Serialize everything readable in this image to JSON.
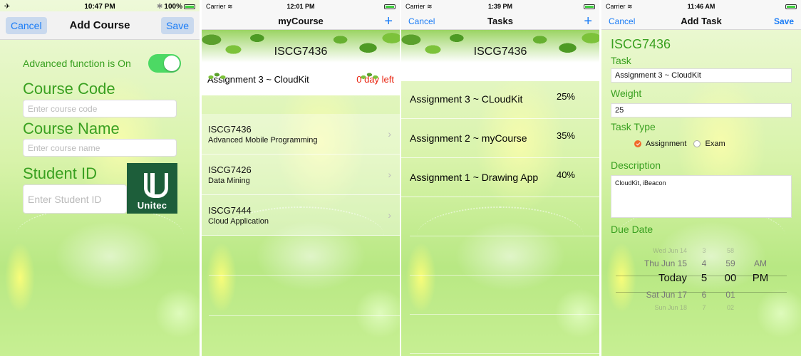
{
  "screen1": {
    "status": {
      "time": "10:47 PM",
      "battery": "100%"
    },
    "nav": {
      "cancel": "Cancel",
      "title": "Add Course",
      "save": "Save"
    },
    "advanced_label": "Advanced function is On",
    "course_code_label": "Course Code",
    "course_code_placeholder": "Enter course code",
    "course_name_label": "Course Name",
    "course_name_placeholder": "Enter course name",
    "student_id_label": "Student ID",
    "student_id_placeholder": "Enter Student ID",
    "logo_text": "Unitec"
  },
  "screen2": {
    "status": {
      "carrier": "Carrier",
      "time": "12:01 PM"
    },
    "nav": {
      "title": "myCourse",
      "add": "+"
    },
    "banner_title": "ISCG7436",
    "assignment": {
      "name": "Assignment 3 ~ CloudKit",
      "days_left": "0 day left"
    },
    "courses": [
      {
        "code": "ISCG7436",
        "name": "Advanced Mobile Programming"
      },
      {
        "code": "ISCG7426",
        "name": "Data Mining"
      },
      {
        "code": "ISCG7444",
        "name": "Cloud Application"
      }
    ]
  },
  "screen3": {
    "status": {
      "carrier": "Carrier",
      "time": "1:39 PM"
    },
    "nav": {
      "cancel": "Cancel",
      "title": "Tasks",
      "add": "+"
    },
    "banner_title": "ISCG7436",
    "tasks": [
      {
        "name": "Assignment 3 ~ CLoudKit",
        "weight": "25%"
      },
      {
        "name": "Assignment 2 ~ myCourse",
        "weight": "35%"
      },
      {
        "name": "Assignment 1 ~ Drawing App",
        "weight": "40%"
      }
    ]
  },
  "screen4": {
    "status": {
      "carrier": "Carrier",
      "time": "11:46 AM"
    },
    "nav": {
      "cancel": "Cancel",
      "title": "Add Task",
      "save": "Save"
    },
    "course_code": "ISCG7436",
    "task_label": "Task",
    "task_value": "Assignment 3 ~ CloudKit",
    "weight_label": "Weight",
    "weight_value": "25",
    "task_type_label": "Task Type",
    "type_options": [
      "Assignment",
      "Exam"
    ],
    "selected_type": "Assignment",
    "description_label": "Description",
    "description_value": "CloudKit, iBeacon",
    "due_date_label": "Due Date",
    "picker_rows": [
      {
        "date": "Wed Jun 14",
        "hour": "3",
        "minute": "58",
        "ampm": ""
      },
      {
        "date": "Thu Jun 15",
        "hour": "4",
        "minute": "59",
        "ampm": "AM"
      },
      {
        "date": "Today",
        "hour": "5",
        "minute": "00",
        "ampm": "PM"
      },
      {
        "date": "Sat Jun 17",
        "hour": "6",
        "minute": "01",
        "ampm": ""
      },
      {
        "date": "Sun Jun 18",
        "hour": "7",
        "minute": "02",
        "ampm": ""
      }
    ]
  },
  "colors": {
    "accent_green": "#39a020",
    "ios_blue": "#1a7cf6",
    "due_red": "#e8220e",
    "radio_orange": "#f06a2b"
  }
}
